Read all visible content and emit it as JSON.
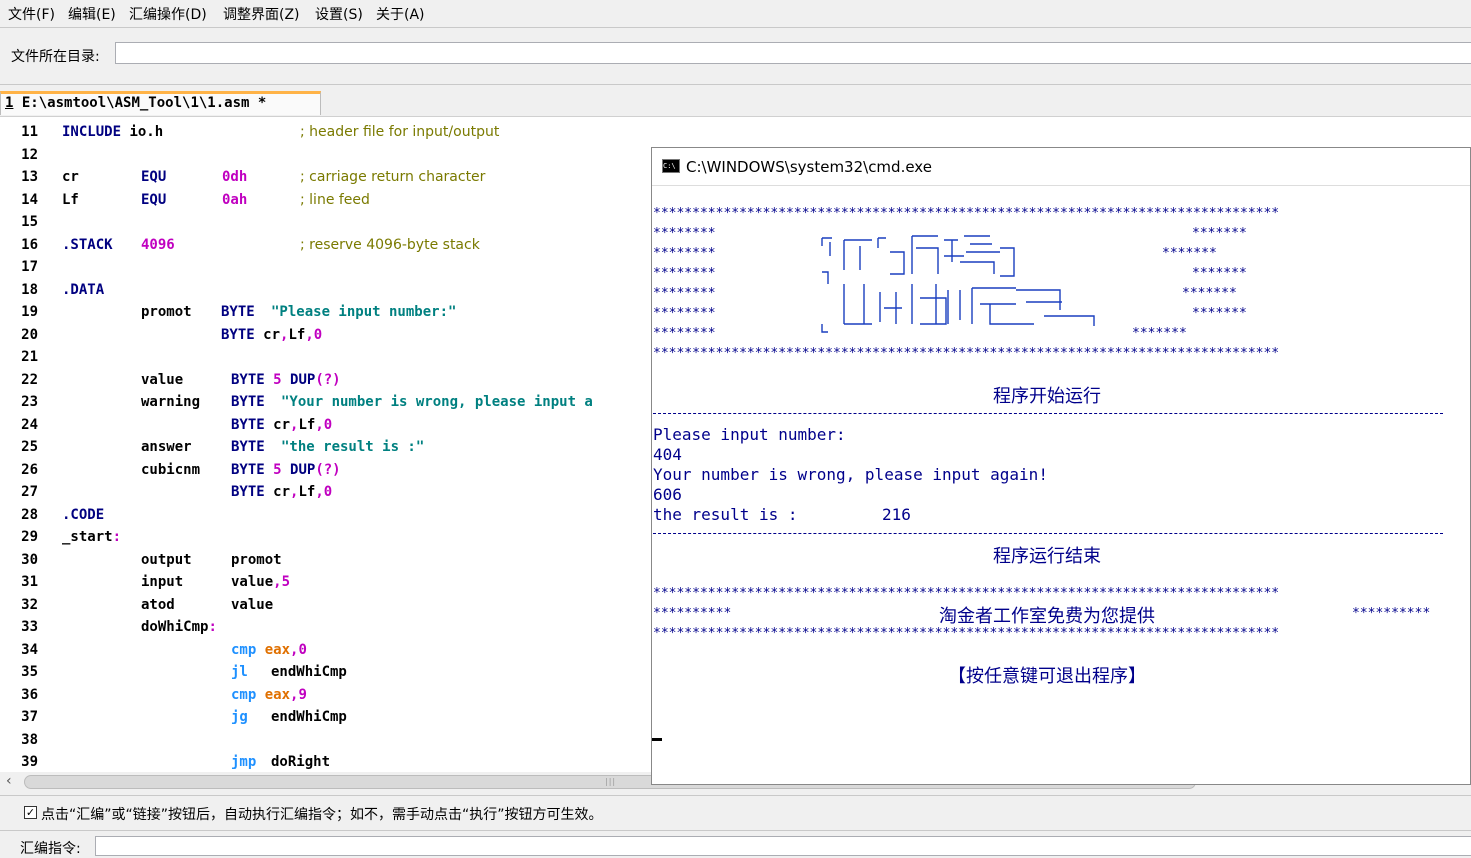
{
  "menu": [
    "文件(F)",
    "编辑(E)",
    "汇编操作(D)",
    "调整界面(Z)",
    "设置(S)",
    "关于(A)"
  ],
  "dir": {
    "label": "文件所在目录:",
    "value": ""
  },
  "tab": {
    "number": "1",
    "path": " E:\\asmtool\\ASM_Tool\\1\\1.asm *"
  },
  "editor": {
    "line_numbers": [
      "11",
      "12",
      "13",
      "14",
      "15",
      "16",
      "17",
      "18",
      "19",
      "20",
      "21",
      "22",
      "23",
      "24",
      "25",
      "26",
      "27",
      "28",
      "29",
      "30",
      "31",
      "32",
      "33",
      "34",
      "35",
      "36",
      "37",
      "38",
      "39"
    ]
  },
  "code": {
    "l11_kw": "INCLUDE",
    "l11_arg": " io.h",
    "l11_comment": "; header file for input/output",
    "l13_name": "cr",
    "l13_kw": "EQU",
    "l13_val": "0dh",
    "l13_comment": "; carriage return character",
    "l14_name": "Lf",
    "l14_kw": "EQU",
    "l14_val": "0ah",
    "l14_comment": "; line feed",
    "l16_kw": ".STACK",
    "l16_val": "4096",
    "l16_comment": "; reserve 4096-byte stack",
    "l18_kw": ".DATA",
    "l19_name": "promot",
    "l19_kw": "BYTE",
    "l19_str": "\"Please input number:\"",
    "l20_kw": "BYTE",
    "l20_a": "cr",
    "l20_c1": ",",
    "l20_b": "Lf",
    "l20_c2": ",",
    "l20_z": "0",
    "l22_name": "value",
    "l22_kw": "BYTE",
    "l22_n": "5",
    "l22_dup": "DUP",
    "l22_p": "(?)",
    "l23_name": "warning",
    "l23_kw": "BYTE",
    "l23_str": "\"Your number is wrong, please input a",
    "l24_kw": "BYTE",
    "l24_a": "cr",
    "l24_c1": ",",
    "l24_b": "Lf",
    "l24_c2": ",",
    "l24_z": "0",
    "l25_name": "answer",
    "l25_kw": "BYTE",
    "l25_str": "\"the result is :\"",
    "l26_name": "cubicnm",
    "l26_kw": "BYTE",
    "l26_n": "5",
    "l26_dup": "DUP",
    "l26_p": "(?)",
    "l27_kw": "BYTE",
    "l27_a": "cr",
    "l27_c1": ",",
    "l27_b": "Lf",
    "l27_c2": ",",
    "l27_z": "0",
    "l28_kw": ".CODE",
    "l29_label": "_start",
    "l29_colon": ":",
    "l30_op": "output",
    "l30_arg": "promot",
    "l31_op": "input",
    "l31_arg": "value",
    "l31_c": ",",
    "l31_n": "5",
    "l32_op": "atod",
    "l32_arg": "value",
    "l33_label": "doWhiCmp",
    "l33_colon": ":",
    "l34_ins": "cmp",
    "l34_reg": "eax",
    "l34_c": ",",
    "l34_n": "0",
    "l35_ins": "jl",
    "l35_arg": "endWhiCmp",
    "l36_ins": "cmp",
    "l36_reg": "eax",
    "l36_c": ",",
    "l36_n": "9",
    "l37_ins": "jg",
    "l37_arg": "endWhiCmp",
    "l39_ins": "jmp",
    "l39_arg": "doRight"
  },
  "options": {
    "checked_mark": "✓",
    "auto_exec_text": "点击“汇编”或“链接”按钮后，自动执行汇编指令；如不，需手动点击“执行”按钮方可生效。"
  },
  "asm_cmd": {
    "label": "汇编指令:"
  },
  "console": {
    "title": "C:\\WINDOWS\\system32\\cmd.exe",
    "icon_text": "C:\\",
    "stars_full": "********************************************************************************",
    "stars8": "********",
    "stars7": "*******",
    "stars10": "**********",
    "start_text": "程序开始运行",
    "prompt": "Please input number:",
    "input1": "404",
    "warning": "Your number is wrong, please input again!",
    "input2": "606",
    "result_label": "the result is :",
    "result_value": "216",
    "end_text": "程序运行结束",
    "credit": "淘金者工作室免费为您提供",
    "exit_hint": "【按任意键可退出程序】"
  },
  "colors": {
    "console_text": "#00008b",
    "tab_accent": "#ffb347",
    "keyword": "#000080",
    "number": "#c000c0",
    "string": "#008080"
  }
}
